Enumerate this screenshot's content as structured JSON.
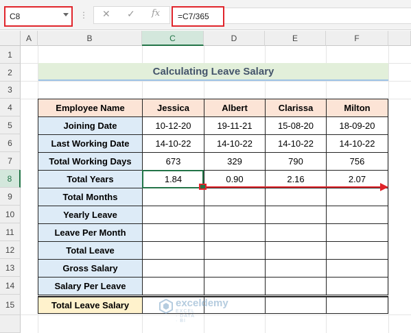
{
  "name_box": {
    "value": "C8"
  },
  "formula_bar": {
    "cancel": "✕",
    "enter": "✓",
    "fx": "fx",
    "formula": "=C7/365"
  },
  "columns": [
    "A",
    "B",
    "C",
    "D",
    "E",
    "F"
  ],
  "rows": [
    "1",
    "2",
    "3",
    "4",
    "5",
    "6",
    "7",
    "8",
    "9",
    "10",
    "11",
    "12",
    "13",
    "14",
    "15"
  ],
  "title": "Calculating Leave Salary",
  "table": {
    "header": [
      "Employee Name",
      "Jessica",
      "Albert",
      "Clarissa",
      "Milton"
    ],
    "rows": [
      {
        "label": "Joining Date",
        "values": [
          "10-12-20",
          "19-11-21",
          "15-08-20",
          "18-09-20"
        ]
      },
      {
        "label": "Last Working Date",
        "values": [
          "14-10-22",
          "14-10-22",
          "14-10-22",
          "14-10-22"
        ]
      },
      {
        "label": "Total Working Days",
        "values": [
          "673",
          "329",
          "790",
          "756"
        ]
      },
      {
        "label": "Total Years",
        "values": [
          "1.84",
          "0.90",
          "2.16",
          "2.07"
        ]
      },
      {
        "label": "Total Months",
        "values": [
          "",
          "",
          "",
          ""
        ]
      },
      {
        "label": "Yearly Leave",
        "values": [
          "",
          "",
          "",
          ""
        ]
      },
      {
        "label": "Leave Per Month",
        "values": [
          "",
          "",
          "",
          ""
        ]
      },
      {
        "label": "Total Leave",
        "values": [
          "",
          "",
          "",
          ""
        ]
      },
      {
        "label": "Gross Salary",
        "values": [
          "",
          "",
          "",
          ""
        ]
      },
      {
        "label": "Salary Per Leave",
        "values": [
          "",
          "",
          "",
          ""
        ]
      }
    ],
    "total": {
      "label": "Total Leave Salary",
      "values": [
        "",
        "",
        "",
        ""
      ]
    }
  },
  "watermark": {
    "name": "exceldemy",
    "tagline": "EXCEL · DATA · BI"
  },
  "colors": {
    "accent": "#217346",
    "highlight": "#e0242a",
    "title_bg": "#e2efda",
    "header_bg": "#fce4d6",
    "label_bg": "#ddebf7",
    "total_bg": "#fff2cc"
  }
}
